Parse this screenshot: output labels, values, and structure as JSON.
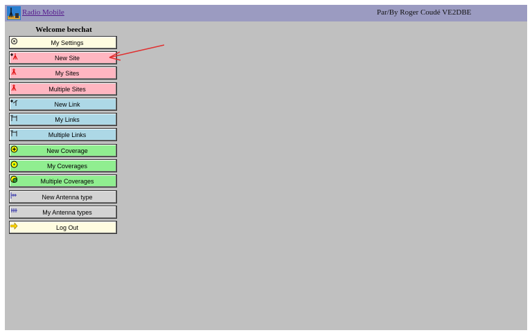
{
  "header": {
    "app_title": "Radio Mobile",
    "author": "Par/By Roger Coudé VE2DBE"
  },
  "welcome": "Welcome beechat",
  "menu": [
    {
      "label": "My Settings",
      "color": "#fffce0",
      "icon": "settings-icon"
    },
    {
      "label": "New Site",
      "color": "#ffb6c1",
      "icon": "new-site-icon"
    },
    {
      "label": "My Sites",
      "color": "#ffb6c1",
      "icon": "site-icon"
    },
    {
      "label": "Multiple Sites",
      "color": "#ffb6c1",
      "icon": "site-icon"
    },
    {
      "label": "New Link",
      "color": "#add8e6",
      "icon": "new-link-icon"
    },
    {
      "label": "My Links",
      "color": "#add8e6",
      "icon": "link-icon"
    },
    {
      "label": "Multiple Links",
      "color": "#add8e6",
      "icon": "link-icon"
    },
    {
      "label": "New Coverage",
      "color": "#90ee90",
      "icon": "new-coverage-icon"
    },
    {
      "label": "My Coverages",
      "color": "#90ee90",
      "icon": "coverage-icon"
    },
    {
      "label": "Multiple Coverages",
      "color": "#90ee90",
      "icon": "multiple-coverage-icon"
    },
    {
      "label": "New Antenna type",
      "color": "#d3d3d3",
      "icon": "new-antenna-icon"
    },
    {
      "label": "My Antenna types",
      "color": "#d3d3d3",
      "icon": "antenna-icon"
    },
    {
      "label": "Log Out",
      "color": "#fffce0",
      "icon": "logout-arrow-icon"
    }
  ],
  "annotation_color": "#e03030"
}
